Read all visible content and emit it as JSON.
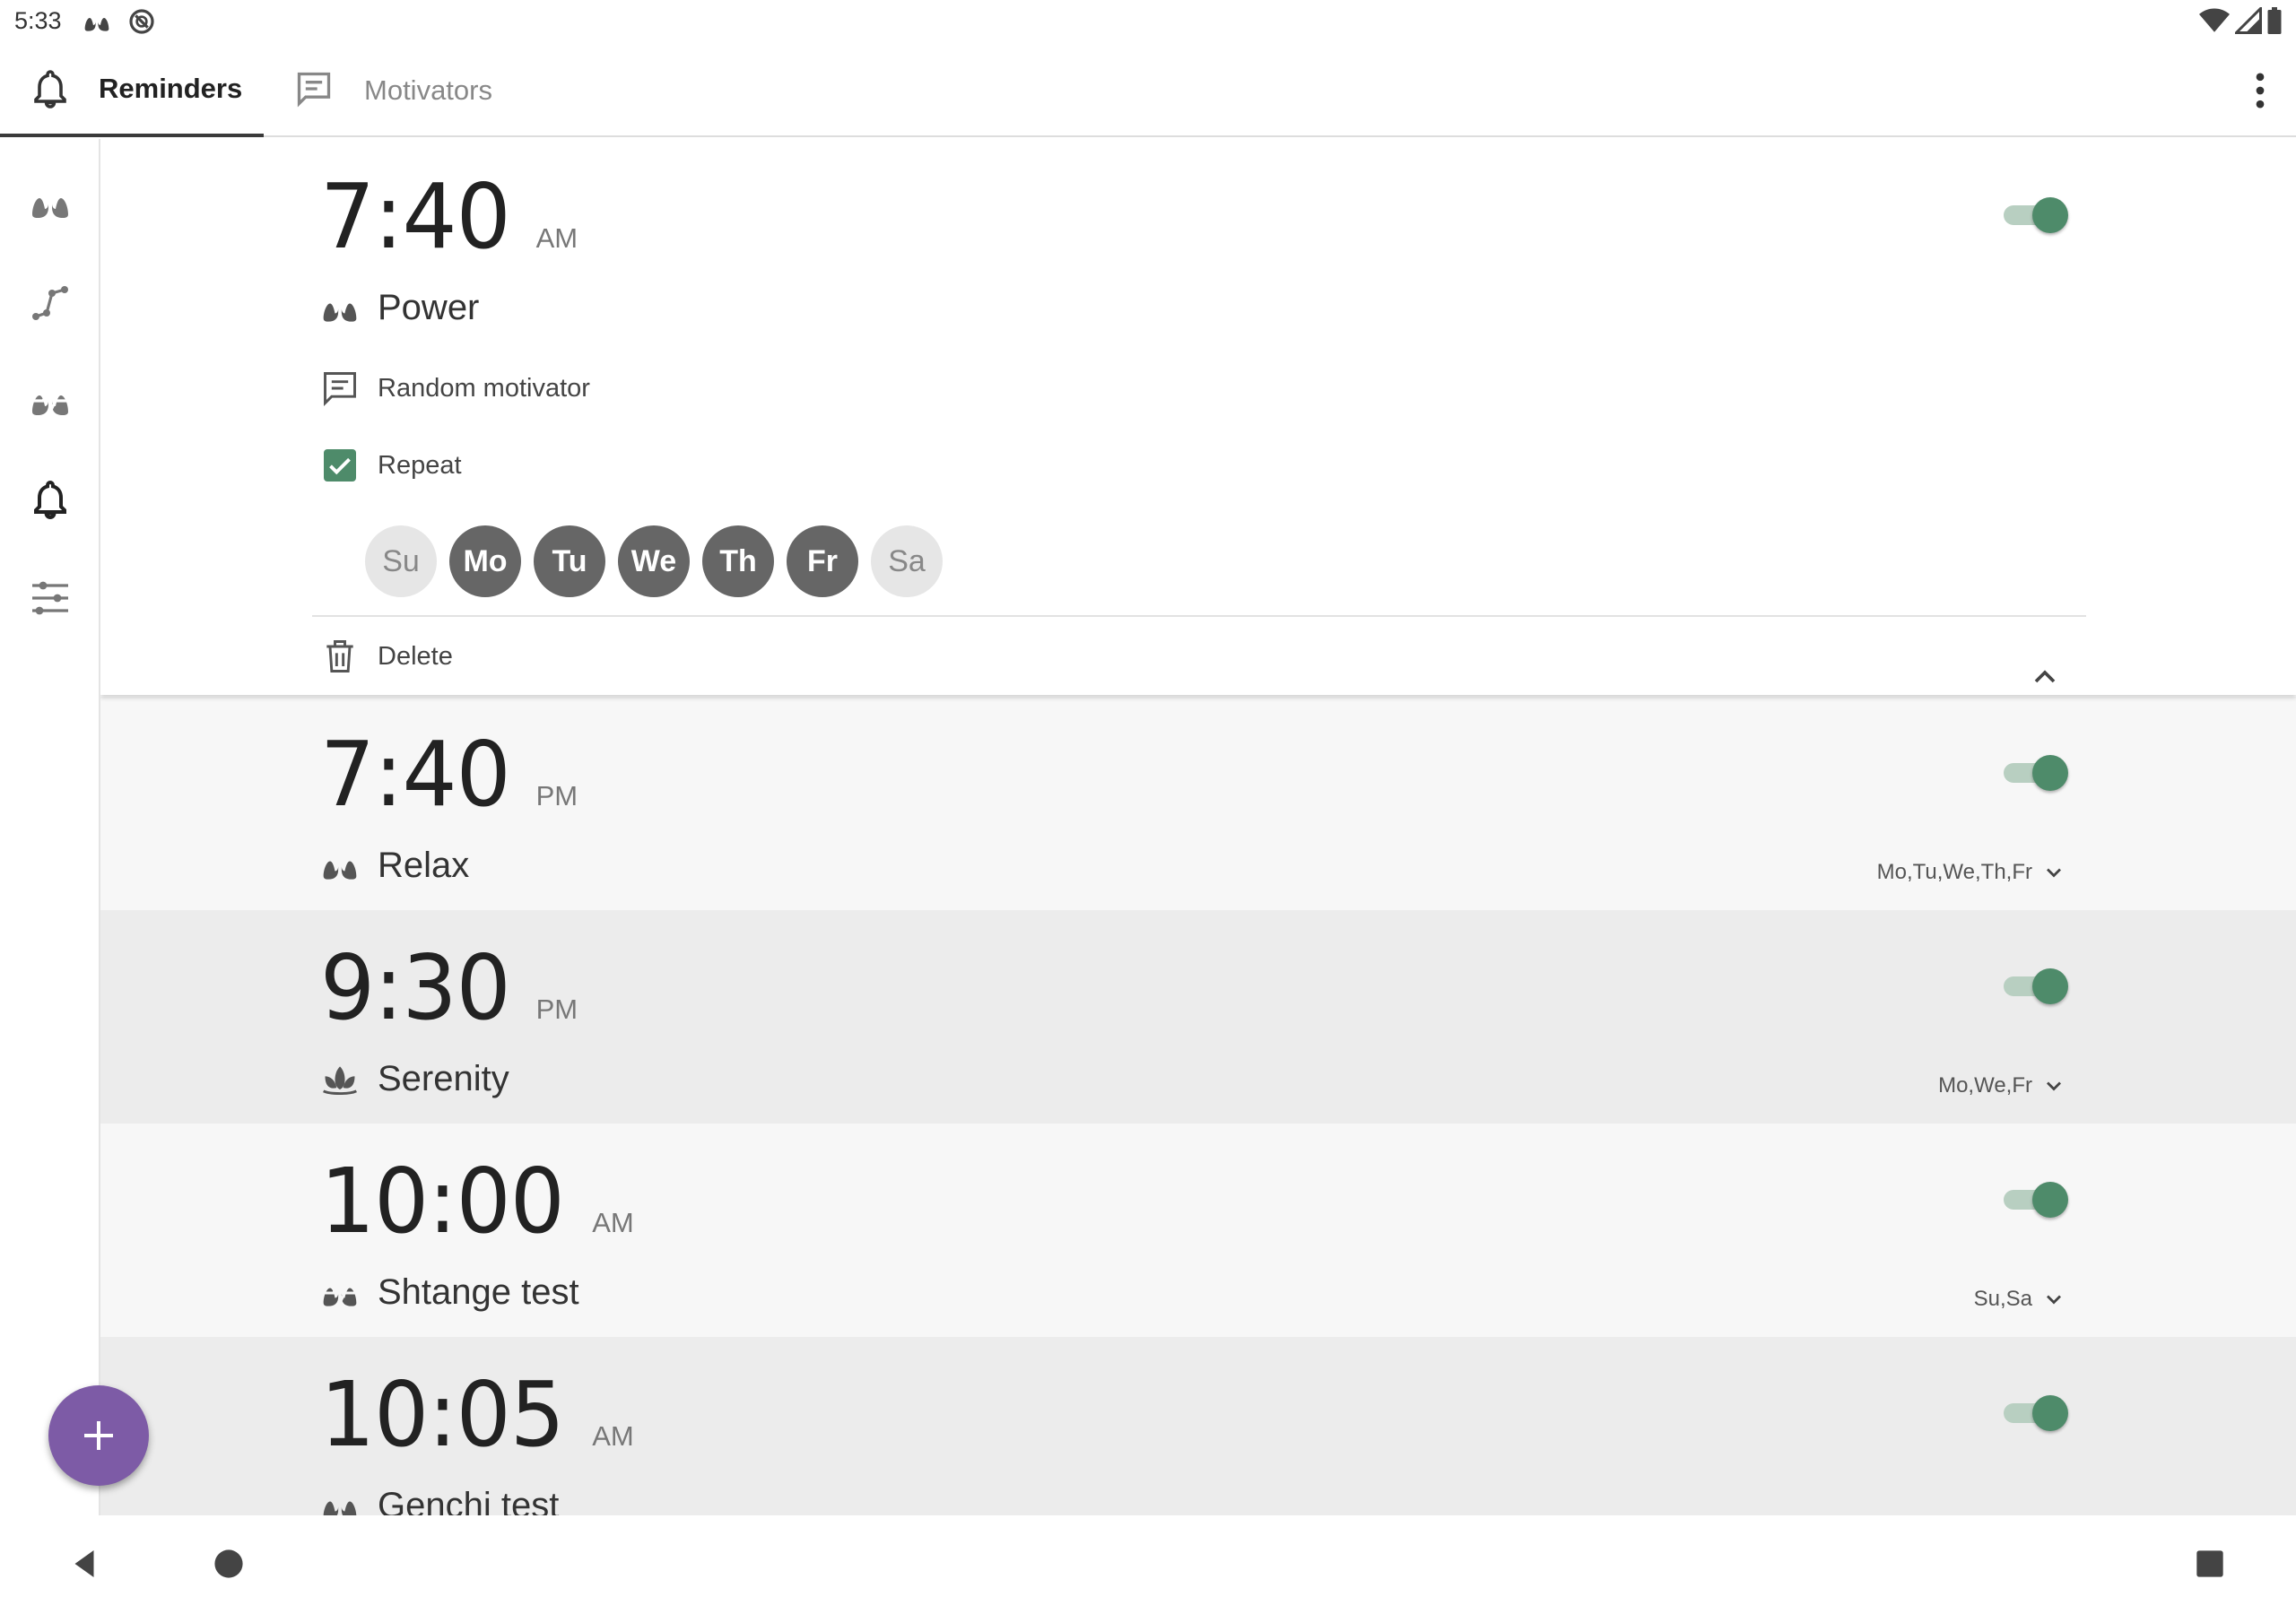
{
  "status_bar": {
    "time": "5:33",
    "left_icons": [
      "lungs-icon",
      "sync-disabled-icon"
    ],
    "right_icons": [
      "wifi-icon",
      "signal-icon",
      "battery-icon"
    ]
  },
  "tabs": [
    {
      "label": "Reminders",
      "icon": "bell-icon",
      "selected": true
    },
    {
      "label": "Motivators",
      "icon": "message-icon",
      "selected": false
    }
  ],
  "side_nav": [
    {
      "icon": "lungs-icon",
      "selected": false
    },
    {
      "icon": "graph-icon",
      "selected": false
    },
    {
      "icon": "brain-icon",
      "selected": false
    },
    {
      "icon": "bell-icon",
      "selected": true
    },
    {
      "icon": "sliders-icon",
      "selected": false
    }
  ],
  "reminders": [
    {
      "time": "7:40",
      "ampm": "AM",
      "exercise": "Power",
      "exercise_icon": "lungs-icon",
      "enabled": true,
      "expanded": true,
      "motivator": "Random motivator",
      "repeat_label": "Repeat",
      "repeat": true,
      "days": [
        {
          "label": "Su",
          "on": false
        },
        {
          "label": "Mo",
          "on": true
        },
        {
          "label": "Tu",
          "on": true
        },
        {
          "label": "We",
          "on": true
        },
        {
          "label": "Th",
          "on": true
        },
        {
          "label": "Fr",
          "on": true
        },
        {
          "label": "Sa",
          "on": false
        }
      ],
      "delete_label": "Delete"
    },
    {
      "time": "7:40",
      "ampm": "PM",
      "exercise": "Relax",
      "exercise_icon": "lungs-icon",
      "enabled": true,
      "days_summary": "Mo,Tu,We,Th,Fr"
    },
    {
      "time": "9:30",
      "ampm": "PM",
      "exercise": "Serenity",
      "exercise_icon": "lotus-icon",
      "enabled": true,
      "days_summary": "Mo,We,Fr"
    },
    {
      "time": "10:00",
      "ampm": "AM",
      "exercise": "Shtange test",
      "exercise_icon": "brain-icon",
      "enabled": true,
      "days_summary": "Su,Sa"
    },
    {
      "time": "10:05",
      "ampm": "AM",
      "exercise": "Genchi test",
      "exercise_icon": "brain-icon",
      "enabled": true
    }
  ],
  "colors": {
    "accent": "#4e8b6a",
    "fab": "#7d5ba6",
    "day_on": "#666666",
    "day_off": "#e6e6e6"
  },
  "fab": {
    "icon": "plus-icon"
  },
  "nav": [
    "back-icon",
    "home-icon",
    "recents-icon"
  ]
}
